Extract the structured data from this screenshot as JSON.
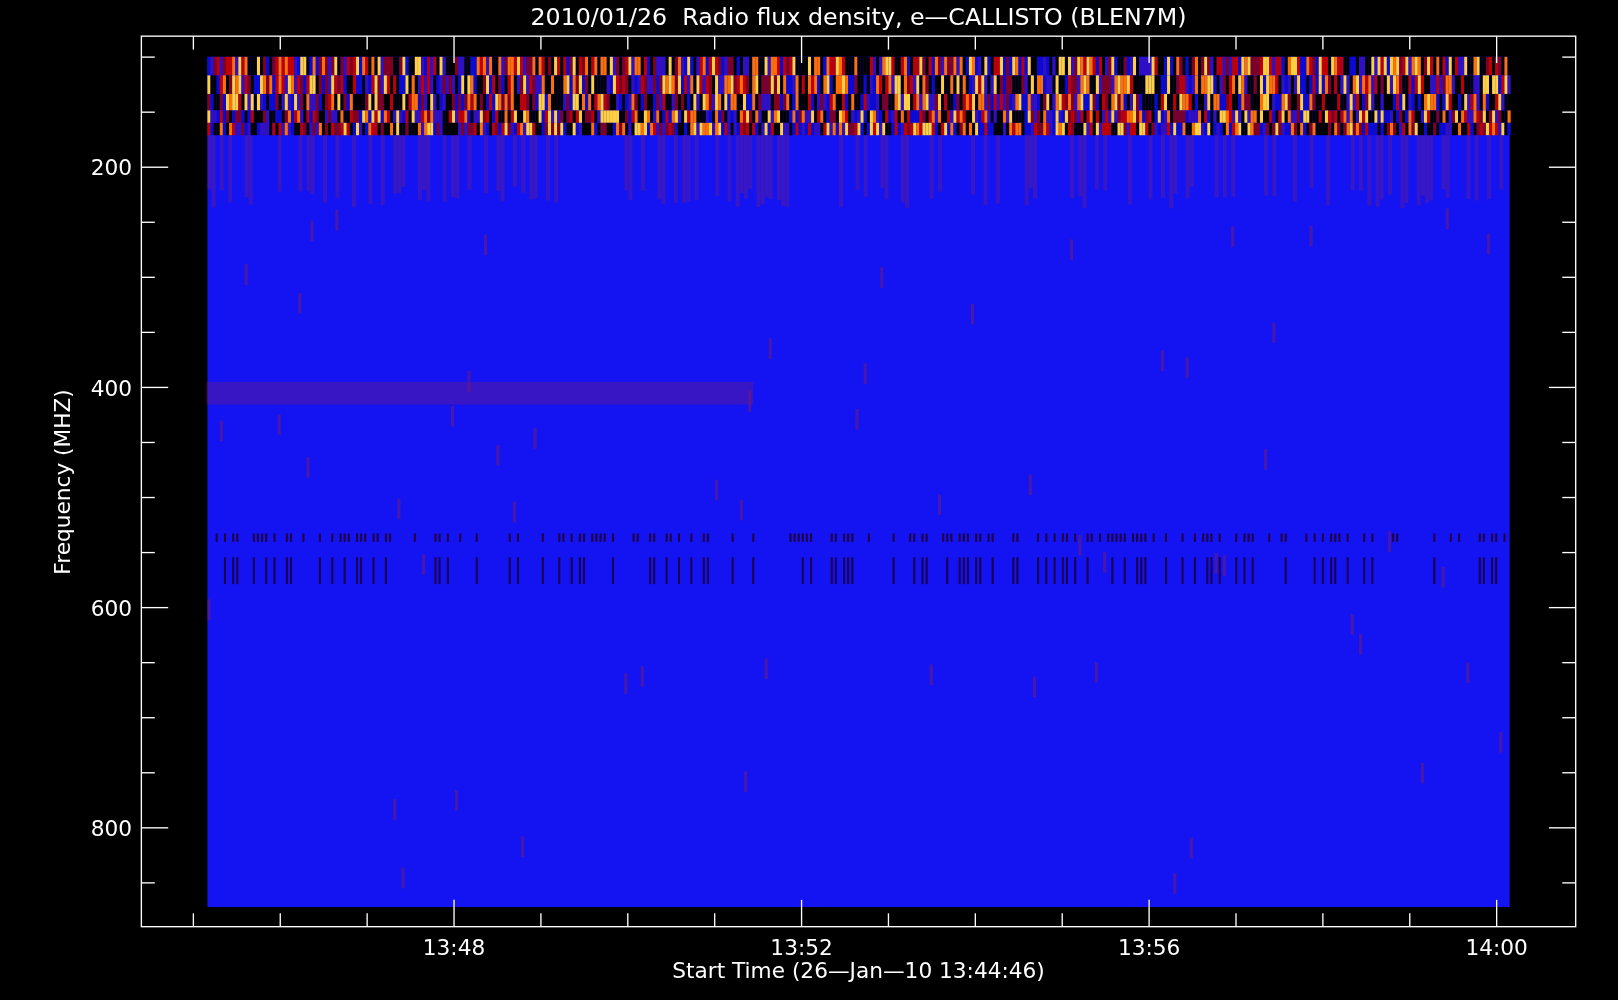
{
  "title": "2010/01/26  Radio flux density, e—CALLISTO (BLEN7M)",
  "y_axis": {
    "label": "Frequency (MHZ)",
    "ticks": [
      "200",
      "400",
      "600",
      "800"
    ]
  },
  "x_axis": {
    "label": "Start Time (26—Jan—10 13:44:46)",
    "ticks": [
      "13:48",
      "13:52",
      "13:56",
      "14:00"
    ]
  }
}
